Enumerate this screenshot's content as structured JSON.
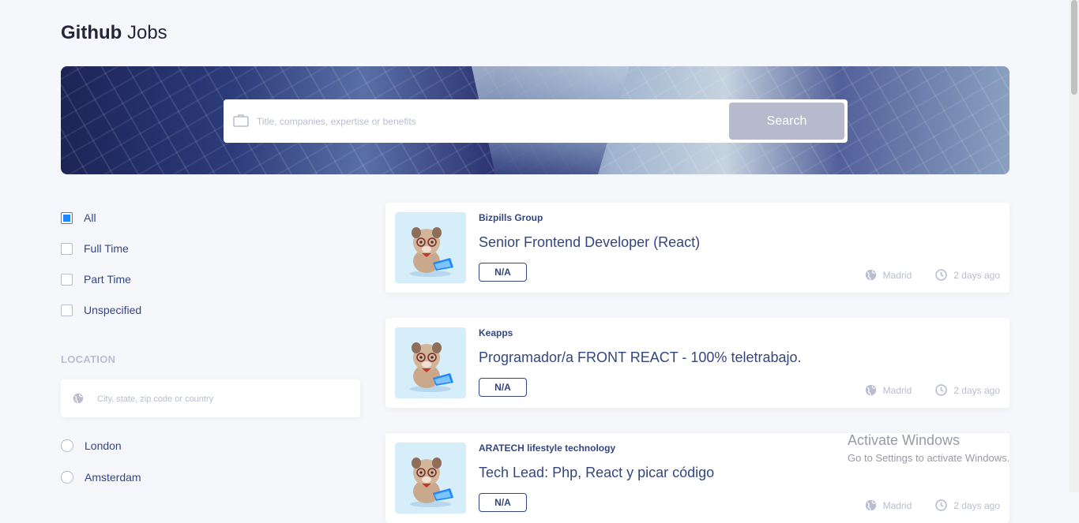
{
  "header": {
    "logo_bold": "Github",
    "logo_light": "Jobs"
  },
  "search": {
    "placeholder": "Title, companies, expertise or benefits",
    "button_label": "Search"
  },
  "filters": {
    "types": [
      {
        "label": "All",
        "checked": true
      },
      {
        "label": "Full Time",
        "checked": false
      },
      {
        "label": "Part Time",
        "checked": false
      },
      {
        "label": "Unspecified",
        "checked": false
      }
    ],
    "location_title": "LOCATION",
    "location_placeholder": "City, state, zip code or country",
    "cities": [
      "London",
      "Amsterdam"
    ]
  },
  "jobs": [
    {
      "company": "Bizpills Group",
      "title": "Senior Frontend Developer (React)",
      "type": "N/A",
      "location": "Madrid",
      "posted": "2 days ago"
    },
    {
      "company": "Keapps",
      "title": "Programador/a FRONT REACT - 100% teletrabajo.",
      "type": "N/A",
      "location": "Madrid",
      "posted": "2 days ago"
    },
    {
      "company": "ARATECH lifestyle technology",
      "title": "Tech Lead: Php, React y picar código",
      "type": "N/A",
      "location": "Madrid",
      "posted": "2 days ago"
    }
  ],
  "watermark": {
    "line1": "Activate Windows",
    "line2": "Go to Settings to activate Windows."
  },
  "colors": {
    "accent": "#1E86FF",
    "text": "#334680",
    "muted": "#B9BDCF",
    "button": "#B7B9CC",
    "logo_bg": "#D6EEFA"
  },
  "icons": [
    "briefcase-icon",
    "globe-icon",
    "clock-icon"
  ]
}
